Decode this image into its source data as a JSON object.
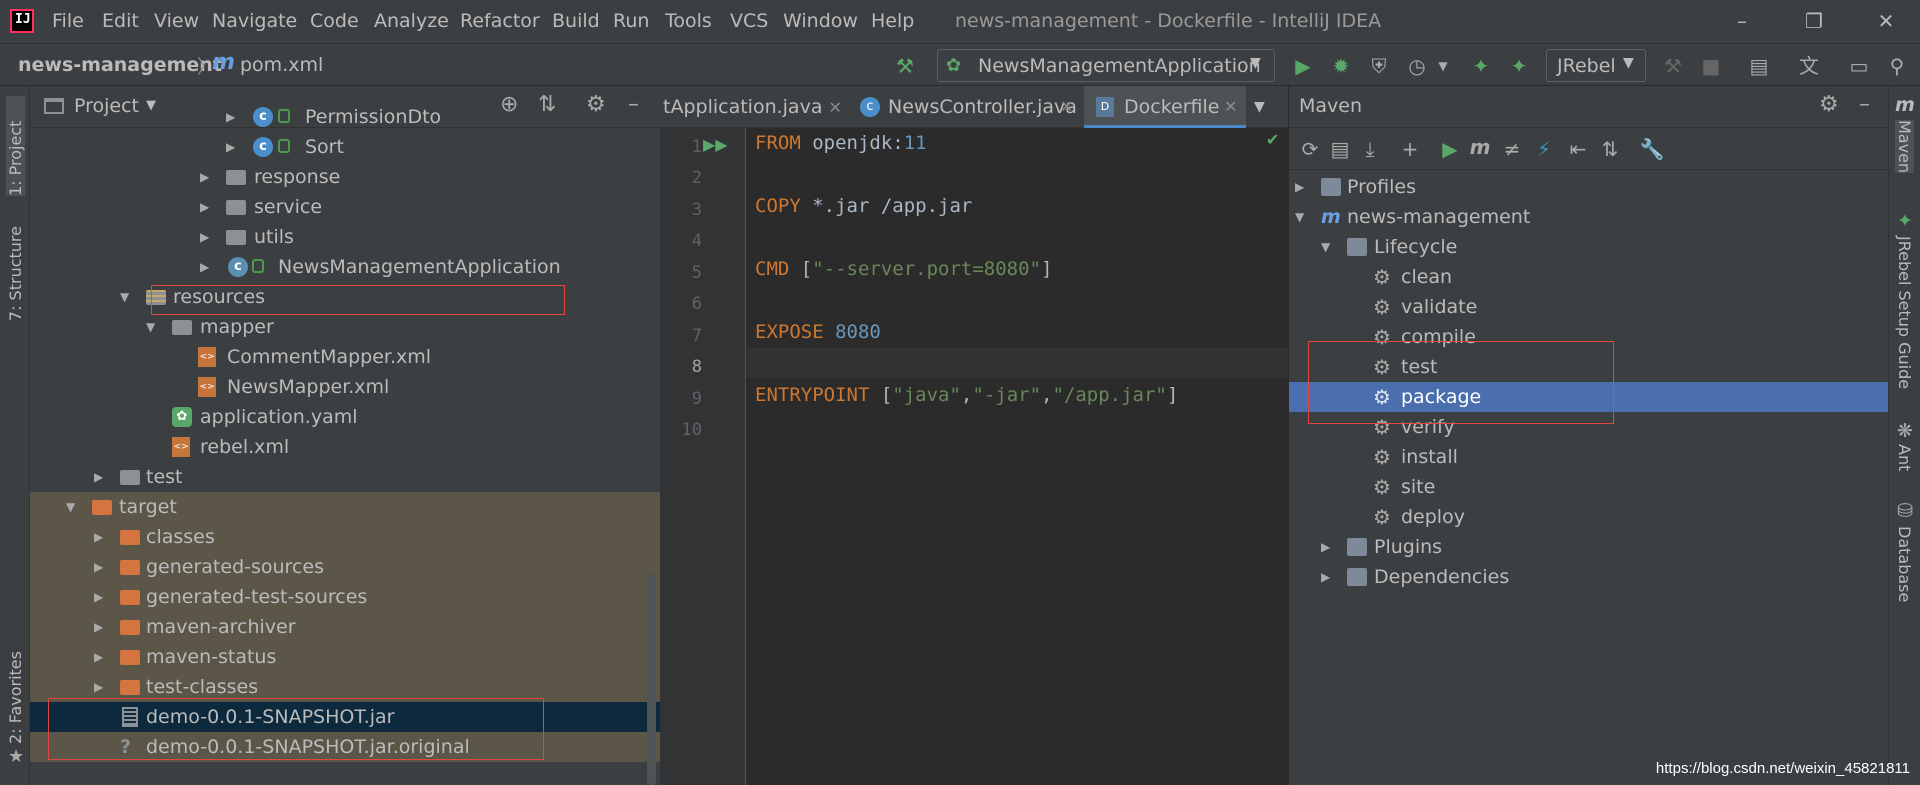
{
  "window": {
    "title": "news-management - Dockerfile - IntelliJ IDEA"
  },
  "menu": [
    "File",
    "Edit",
    "View",
    "Navigate",
    "Code",
    "Analyze",
    "Refactor",
    "Build",
    "Run",
    "Tools",
    "VCS",
    "Window",
    "Help"
  ],
  "breadcrumb": {
    "project": "news-management",
    "file": "pom.xml"
  },
  "toolbar": {
    "run_config": "NewsManagementApplication",
    "jrebel": "JRebel"
  },
  "left_strip": {
    "project": "1: Project",
    "structure": "7: Structure",
    "favorites": "2: Favorites"
  },
  "project_panel": {
    "title": "Project",
    "rows": [
      {
        "label": "PermissionDto"
      },
      {
        "label": "Sort"
      },
      {
        "label": "response"
      },
      {
        "label": "service"
      },
      {
        "label": "utils"
      },
      {
        "label": "NewsManagementApplication"
      },
      {
        "label": "resources"
      },
      {
        "label": "mapper"
      },
      {
        "label": "CommentMapper.xml"
      },
      {
        "label": "NewsMapper.xml"
      },
      {
        "label": "application.yaml"
      },
      {
        "label": "rebel.xml"
      },
      {
        "label": "test"
      },
      {
        "label": "target"
      },
      {
        "label": "classes"
      },
      {
        "label": "generated-sources"
      },
      {
        "label": "generated-test-sources"
      },
      {
        "label": "maven-archiver"
      },
      {
        "label": "maven-status"
      },
      {
        "label": "test-classes"
      },
      {
        "label": "demo-0.0.1-SNAPSHOT.jar"
      },
      {
        "label": "demo-0.0.1-SNAPSHOT.jar.original"
      }
    ]
  },
  "editor": {
    "tabs": [
      {
        "label": "tApplication.java"
      },
      {
        "label": "NewsController.java"
      },
      {
        "label": "Dockerfile"
      }
    ],
    "line_numbers": [
      "1",
      "2",
      "3",
      "4",
      "5",
      "6",
      "7",
      "8",
      "9",
      "10"
    ],
    "code": {
      "l1_kw": "FROM",
      "l1_rest": " openjdk:",
      "l1_num": "11",
      "l3_kw": "COPY",
      "l3_rest": " *.jar /app.jar",
      "l5_kw": "CMD",
      "l5_b1": " [",
      "l5_str": "\"--server.port=8080\"",
      "l5_b2": "]",
      "l7_kw": "EXPOSE",
      "l7_num": " 8080",
      "l9_kw": "ENTRYPOINT",
      "l9_b1": " [",
      "l9_s1": "\"java\"",
      "l9_c1": ",",
      "l9_s2": "\"-jar\"",
      "l9_c2": ",",
      "l9_s3": "\"/app.jar\"",
      "l9_b2": "]"
    }
  },
  "maven": {
    "title": "Maven",
    "rows": [
      {
        "label": "Profiles"
      },
      {
        "label": "news-management"
      },
      {
        "label": "Lifecycle"
      },
      {
        "label": "clean"
      },
      {
        "label": "validate"
      },
      {
        "label": "compile"
      },
      {
        "label": "test"
      },
      {
        "label": "package"
      },
      {
        "label": "verify"
      },
      {
        "label": "install"
      },
      {
        "label": "site"
      },
      {
        "label": "deploy"
      },
      {
        "label": "Plugins"
      },
      {
        "label": "Dependencies"
      }
    ]
  },
  "right_strip": {
    "maven": "Maven",
    "jrebel": "JRebel Setup Guide",
    "ant": "Ant",
    "database": "Database"
  },
  "watermark": "https://blog.csdn.net/weixin_45821811"
}
